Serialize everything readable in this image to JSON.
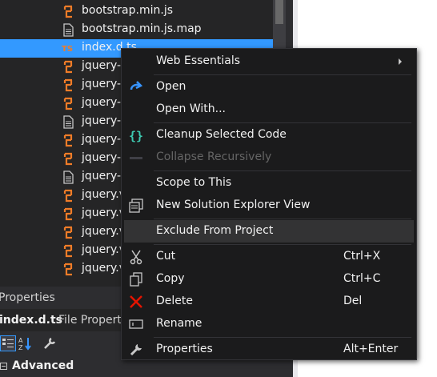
{
  "solution_explorer": {
    "files": [
      {
        "name": "bootstrap.min.js",
        "type": "js"
      },
      {
        "name": "bootstrap.min.js.map",
        "type": "map"
      },
      {
        "name": "index.d.ts",
        "type": "ts",
        "selected": true
      },
      {
        "name": "jquery-",
        "type": "js"
      },
      {
        "name": "jquery-",
        "type": "js"
      },
      {
        "name": "jquery-",
        "type": "js"
      },
      {
        "name": "jquery-",
        "type": "map"
      },
      {
        "name": "jquery-",
        "type": "js"
      },
      {
        "name": "jquery-",
        "type": "js"
      },
      {
        "name": "jquery-",
        "type": "map"
      },
      {
        "name": "jquery.v",
        "type": "js"
      },
      {
        "name": "jquery.v",
        "type": "js"
      },
      {
        "name": "jquery.v",
        "type": "js"
      },
      {
        "name": "jquery.v",
        "type": "js"
      },
      {
        "name": "jquery.v",
        "type": "js"
      }
    ]
  },
  "properties": {
    "header": "Properties",
    "target_name": "index.d.ts",
    "target_kind": "File Propert",
    "category": "Advanced"
  },
  "context_menu": {
    "items": [
      {
        "label": "Web Essentials",
        "icon": "none",
        "submenu": true
      },
      {
        "separator": true
      },
      {
        "label": "Open",
        "icon": "open-arrow-icon"
      },
      {
        "label": "Open With...",
        "icon": "none"
      },
      {
        "separator": true
      },
      {
        "label": "Cleanup Selected Code",
        "icon": "braces-icon"
      },
      {
        "label": "Collapse Recursively",
        "icon": "collapse-icon",
        "disabled": true
      },
      {
        "separator": true
      },
      {
        "label": "Scope to This",
        "icon": "none"
      },
      {
        "label": "New Solution Explorer View",
        "icon": "new-window-icon"
      },
      {
        "separator": true
      },
      {
        "label": "Exclude From Project",
        "icon": "none",
        "hover": true
      },
      {
        "separator": true
      },
      {
        "label": "Cut",
        "icon": "scissors-icon",
        "shortcut": "Ctrl+X"
      },
      {
        "label": "Copy",
        "icon": "copy-icon",
        "shortcut": "Ctrl+C"
      },
      {
        "label": "Delete",
        "icon": "delete-x-icon",
        "shortcut": "Del"
      },
      {
        "label": "Rename",
        "icon": "rename-icon"
      },
      {
        "separator": true
      },
      {
        "label": "Properties",
        "icon": "wrench-icon",
        "shortcut": "Alt+Enter"
      }
    ]
  },
  "colors": {
    "selection": "#3399ff",
    "js_icon": "#f07c28",
    "ts_icon": "#f07c28",
    "open_icon": "#3794ff",
    "braces_icon": "#3dc9b0",
    "delete_icon": "#e51400"
  }
}
